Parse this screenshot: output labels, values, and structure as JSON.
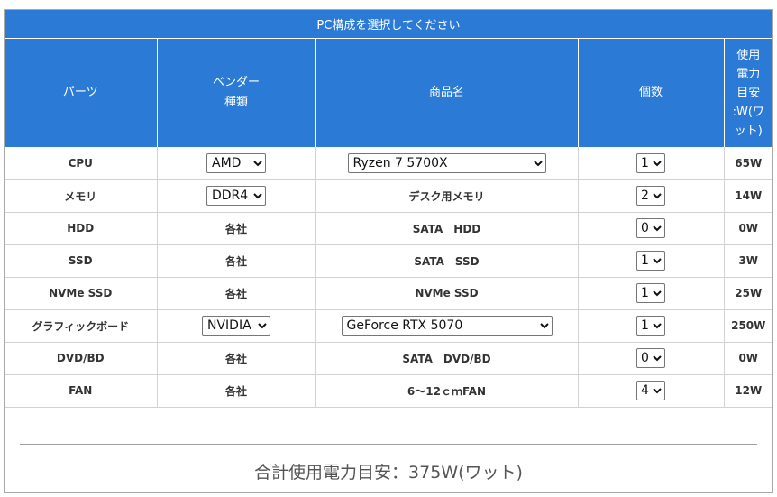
{
  "table": {
    "title": "PC構成を選択してください",
    "headers": {
      "parts": "パーツ",
      "vendor_l1": "ベンダー",
      "vendor_l2": "種類",
      "product": "商品名",
      "count": "個数",
      "power_l1": "使用",
      "power_l2": "電力",
      "power_l3": "目安",
      "power_l4": ":W(ワ",
      "power_l5": "ット)"
    },
    "rows": [
      {
        "part": "CPU",
        "vendor": "AMD",
        "vendor_is_select": true,
        "product": "Ryzen 7 5700X",
        "product_is_select": true,
        "count": "1",
        "power": "65W"
      },
      {
        "part": "メモリ",
        "vendor": "DDR4",
        "vendor_is_select": true,
        "product": "デスク用メモリ",
        "product_is_select": false,
        "count": "2",
        "power": "14W"
      },
      {
        "part": "HDD",
        "vendor": "各社",
        "vendor_is_select": false,
        "product": "SATA　HDD",
        "product_is_select": false,
        "count": "0",
        "power": "0W"
      },
      {
        "part": "SSD",
        "vendor": "各社",
        "vendor_is_select": false,
        "product": "SATA　SSD",
        "product_is_select": false,
        "count": "1",
        "power": "3W"
      },
      {
        "part": "NVMe SSD",
        "vendor": "各社",
        "vendor_is_select": false,
        "product": "NVMe SSD",
        "product_is_select": false,
        "count": "1",
        "power": "25W"
      },
      {
        "part": "グラフィックボード",
        "vendor": "NVIDIA",
        "vendor_is_select": true,
        "product": "GeForce RTX 5070",
        "product_is_select": true,
        "count": "1",
        "power": "250W"
      },
      {
        "part": "DVD/BD",
        "vendor": "各社",
        "vendor_is_select": false,
        "product": "SATA　DVD/BD",
        "product_is_select": false,
        "count": "0",
        "power": "0W"
      },
      {
        "part": "FAN",
        "vendor": "各社",
        "vendor_is_select": false,
        "product": "6～12ｃｍFAN",
        "product_is_select": false,
        "count": "4",
        "power": "12W"
      }
    ]
  },
  "total": {
    "label": "合計使用電力目安：375W(ワット)"
  },
  "colors": {
    "header_bg": "#2b7ad6",
    "header_text": "#ffffff",
    "border": "#d2d2d2"
  }
}
